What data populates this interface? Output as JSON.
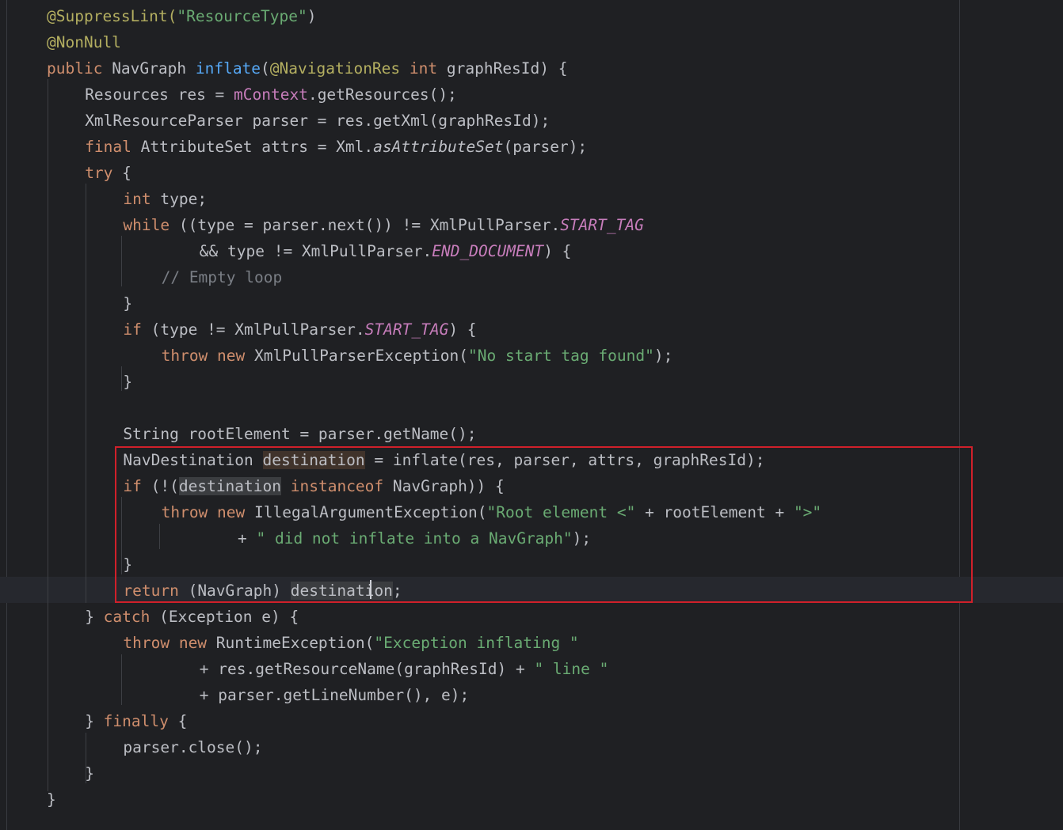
{
  "editor": {
    "lines": [
      {
        "indent": 0,
        "tokens": [
          {
            "t": "@SuppressLint(",
            "c": "anno"
          },
          {
            "t": "\"ResourceType\"",
            "c": "str"
          },
          {
            "t": ")",
            "c": "plain"
          }
        ]
      },
      {
        "indent": 0,
        "tokens": [
          {
            "t": "@NonNull",
            "c": "anno"
          }
        ]
      },
      {
        "indent": 0,
        "tokens": [
          {
            "t": "public ",
            "c": "kw"
          },
          {
            "t": "NavGraph ",
            "c": "plain"
          },
          {
            "t": "inflate",
            "c": "fn"
          },
          {
            "t": "(",
            "c": "plain"
          },
          {
            "t": "@NavigationRes ",
            "c": "anno"
          },
          {
            "t": "int ",
            "c": "kw"
          },
          {
            "t": "graphResId) {",
            "c": "plain"
          }
        ]
      },
      {
        "indent": 1,
        "tokens": [
          {
            "t": "Resources res = ",
            "c": "plain"
          },
          {
            "t": "mContext",
            "c": "field"
          },
          {
            "t": ".getResources();",
            "c": "plain"
          }
        ]
      },
      {
        "indent": 1,
        "tokens": [
          {
            "t": "XmlResourceParser parser = res.getXml(graphResId);",
            "c": "plain"
          }
        ]
      },
      {
        "indent": 1,
        "tokens": [
          {
            "t": "final ",
            "c": "kw"
          },
          {
            "t": "AttributeSet attrs = Xml.",
            "c": "plain"
          },
          {
            "t": "asAttributeSet",
            "c": "static"
          },
          {
            "t": "(parser);",
            "c": "plain"
          }
        ]
      },
      {
        "indent": 1,
        "tokens": [
          {
            "t": "try ",
            "c": "kw"
          },
          {
            "t": "{",
            "c": "plain"
          }
        ]
      },
      {
        "indent": 2,
        "tokens": [
          {
            "t": "int ",
            "c": "kw"
          },
          {
            "t": "type;",
            "c": "plain"
          }
        ]
      },
      {
        "indent": 2,
        "tokens": [
          {
            "t": "while ",
            "c": "kw"
          },
          {
            "t": "((type = parser.next()) != XmlPullParser.",
            "c": "plain"
          },
          {
            "t": "START_TAG",
            "c": "const"
          }
        ]
      },
      {
        "indent": 4,
        "tokens": [
          {
            "t": "&& type != XmlPullParser.",
            "c": "plain"
          },
          {
            "t": "END_DOCUMENT",
            "c": "const"
          },
          {
            "t": ") {",
            "c": "plain"
          }
        ]
      },
      {
        "indent": 3,
        "tokens": [
          {
            "t": "// Empty loop",
            "c": "cmt"
          }
        ]
      },
      {
        "indent": 2,
        "tokens": [
          {
            "t": "}",
            "c": "plain"
          }
        ]
      },
      {
        "indent": 2,
        "tokens": [
          {
            "t": "if ",
            "c": "kw"
          },
          {
            "t": "(type != XmlPullParser.",
            "c": "plain"
          },
          {
            "t": "START_TAG",
            "c": "const"
          },
          {
            "t": ") {",
            "c": "plain"
          }
        ]
      },
      {
        "indent": 3,
        "tokens": [
          {
            "t": "throw new ",
            "c": "kw"
          },
          {
            "t": "XmlPullParserException(",
            "c": "plain"
          },
          {
            "t": "\"No start tag found\"",
            "c": "str"
          },
          {
            "t": ");",
            "c": "plain"
          }
        ]
      },
      {
        "indent": 2,
        "tokens": [
          {
            "t": "}",
            "c": "plain"
          }
        ]
      },
      {
        "indent": 0,
        "tokens": []
      },
      {
        "indent": 2,
        "tokens": [
          {
            "t": "String rootElement = parser.getName();",
            "c": "plain"
          }
        ]
      },
      {
        "indent": 2,
        "tokens": [
          {
            "t": "NavDestination ",
            "c": "plain"
          },
          {
            "t": "destination",
            "c": "plain",
            "hl": "write"
          },
          {
            "t": " = inflate(res, parser, attrs, graphResId);",
            "c": "plain"
          }
        ]
      },
      {
        "indent": 2,
        "tokens": [
          {
            "t": "if ",
            "c": "kw"
          },
          {
            "t": "(!(",
            "c": "plain"
          },
          {
            "t": "destination",
            "c": "plain",
            "hl": "read"
          },
          {
            "t": " ",
            "c": "plain"
          },
          {
            "t": "instanceof ",
            "c": "kw"
          },
          {
            "t": "NavGraph)) {",
            "c": "plain"
          }
        ]
      },
      {
        "indent": 3,
        "tokens": [
          {
            "t": "throw new ",
            "c": "kw"
          },
          {
            "t": "IllegalArgumentException(",
            "c": "plain"
          },
          {
            "t": "\"Root element <\"",
            "c": "str"
          },
          {
            "t": " + rootElement + ",
            "c": "plain"
          },
          {
            "t": "\">\"",
            "c": "str"
          }
        ]
      },
      {
        "indent": 5,
        "tokens": [
          {
            "t": "+ ",
            "c": "plain"
          },
          {
            "t": "\" did not inflate into a NavGraph\"",
            "c": "str"
          },
          {
            "t": ");",
            "c": "plain"
          }
        ]
      },
      {
        "indent": 2,
        "tokens": [
          {
            "t": "}",
            "c": "plain"
          }
        ]
      },
      {
        "indent": 2,
        "tokens": [
          {
            "t": "return ",
            "c": "kw"
          },
          {
            "t": "(NavGraph) ",
            "c": "plain"
          },
          {
            "t": "destination",
            "c": "plain",
            "hl": "read"
          },
          {
            "t": ";",
            "c": "plain"
          }
        ]
      },
      {
        "indent": 1,
        "tokens": [
          {
            "t": "} ",
            "c": "plain"
          },
          {
            "t": "catch ",
            "c": "kw"
          },
          {
            "t": "(Exception e) {",
            "c": "plain"
          }
        ]
      },
      {
        "indent": 2,
        "tokens": [
          {
            "t": "throw new ",
            "c": "kw"
          },
          {
            "t": "RuntimeException(",
            "c": "plain"
          },
          {
            "t": "\"Exception inflating \"",
            "c": "str"
          }
        ]
      },
      {
        "indent": 4,
        "tokens": [
          {
            "t": "+ res.getResourceName(graphResId) + ",
            "c": "plain"
          },
          {
            "t": "\" line \"",
            "c": "str"
          }
        ]
      },
      {
        "indent": 4,
        "tokens": [
          {
            "t": "+ parser.getLineNumber(), e);",
            "c": "plain"
          }
        ]
      },
      {
        "indent": 1,
        "tokens": [
          {
            "t": "} ",
            "c": "plain"
          },
          {
            "t": "finally ",
            "c": "kw"
          },
          {
            "t": "{",
            "c": "plain"
          }
        ]
      },
      {
        "indent": 2,
        "tokens": [
          {
            "t": "parser.close();",
            "c": "plain"
          }
        ]
      },
      {
        "indent": 1,
        "tokens": [
          {
            "t": "}",
            "c": "plain"
          }
        ]
      },
      {
        "indent": 0,
        "tokens": [
          {
            "t": "}",
            "c": "plain"
          }
        ]
      }
    ],
    "colors": {
      "background": "#1f2023",
      "keyword": "#cf8e6d",
      "annotation": "#b3ae60",
      "string": "#6aab73",
      "function": "#56a8f5",
      "field": "#c77dbb",
      "comment": "#7a7e85",
      "highlight_box": "#d0202a"
    }
  }
}
